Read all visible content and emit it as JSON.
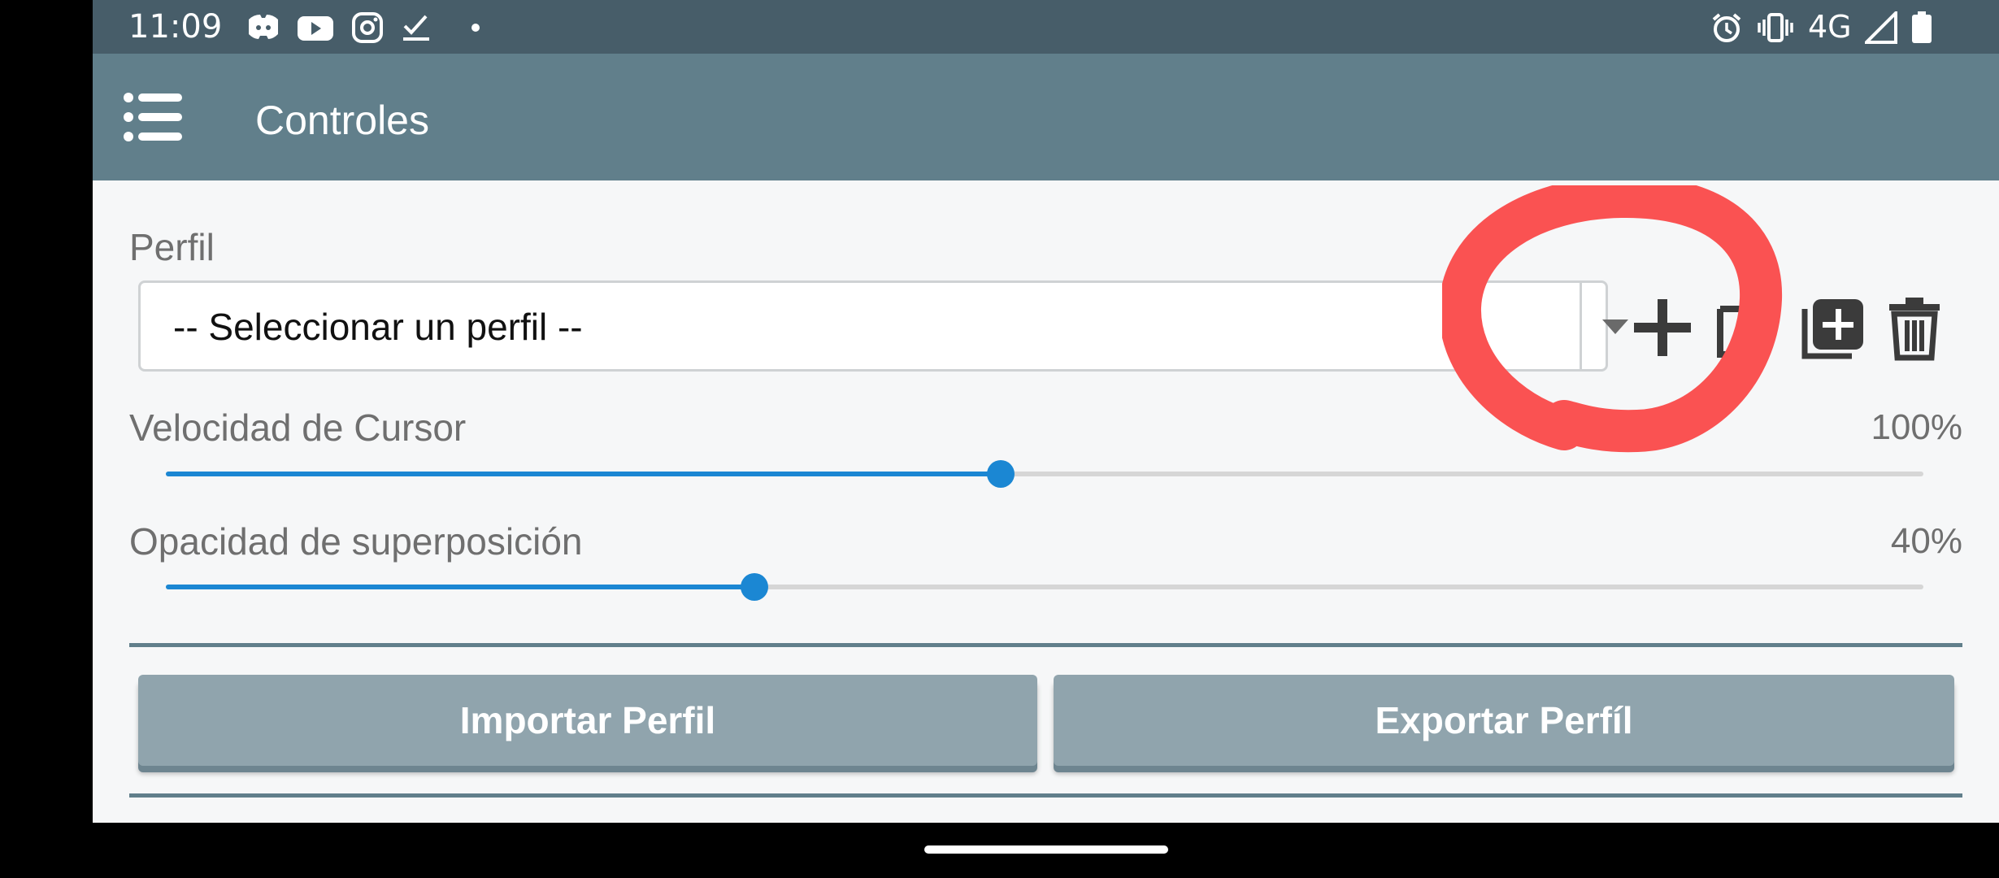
{
  "status_bar": {
    "time": "11:09",
    "network": "4G",
    "icons": [
      "discord-icon",
      "youtube-icon",
      "instagram-icon",
      "tasks-check-icon",
      "dot-icon",
      "alarm-icon",
      "vibrate-icon",
      "signal-icon",
      "battery-icon"
    ]
  },
  "app_bar": {
    "title": "Controles",
    "menu_icon": "menu-list-icon"
  },
  "profile": {
    "label": "Perfil",
    "select_value": "-- Seleccionar un perfil --",
    "actions": [
      "add-icon",
      "edit-icon",
      "duplicate-icon",
      "delete-icon"
    ]
  },
  "cursor_speed": {
    "label": "Velocidad de Cursor",
    "value_text": "100%",
    "slider_fraction": 0.475
  },
  "overlay_opacity": {
    "label": "Opacidad de superposición",
    "value_text": "40%",
    "slider_fraction": 0.335
  },
  "buttons": {
    "import_label": "Importar Perfil",
    "export_label": "Exportar Perfíl"
  },
  "colors": {
    "status_bar": "#475d69",
    "app_bar": "#617f8b",
    "accent": "#1b87d3",
    "button": "#90a4ad",
    "annotation": "#fa5252"
  }
}
